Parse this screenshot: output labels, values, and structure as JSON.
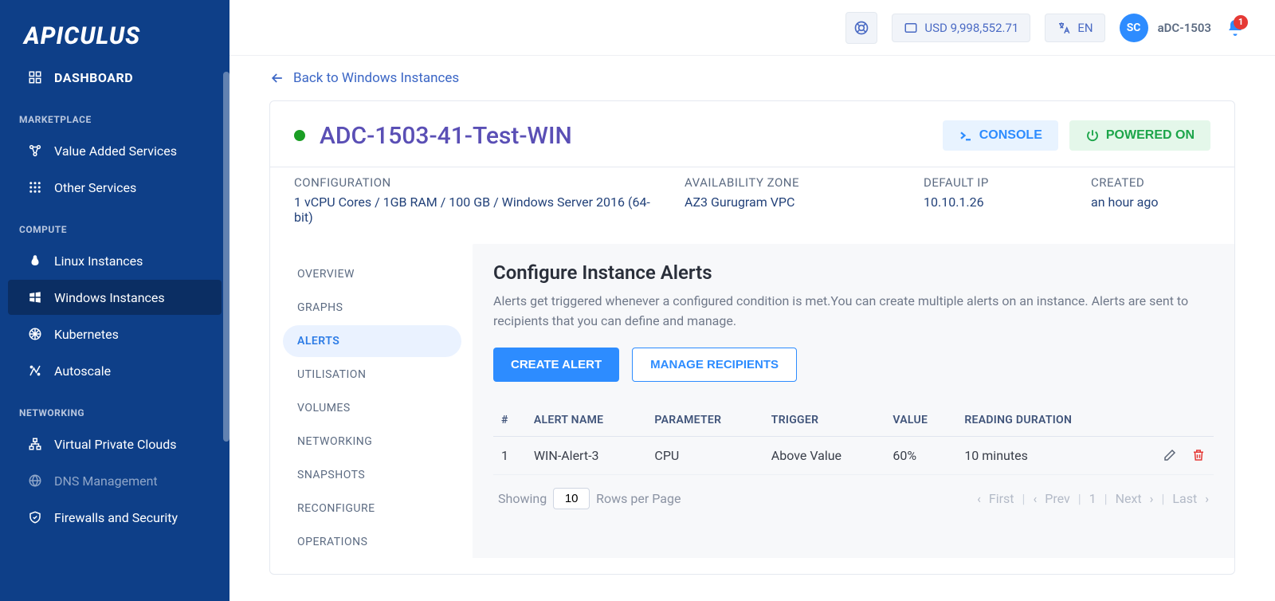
{
  "brand": "APICULUS",
  "topbar": {
    "balance": "USD 9,998,552.71",
    "language": "EN",
    "avatar_initials": "SC",
    "account_label": "aDC-1503",
    "notification_count": "1"
  },
  "sidebar": {
    "dashboard": "DASHBOARD",
    "sections": [
      {
        "label": "MARKETPLACE",
        "items": [
          {
            "icon": "vas",
            "label": "Value Added Services"
          },
          {
            "icon": "grid",
            "label": "Other Services"
          }
        ]
      },
      {
        "label": "COMPUTE",
        "items": [
          {
            "icon": "linux",
            "label": "Linux Instances"
          },
          {
            "icon": "windows",
            "label": "Windows Instances",
            "active": true
          },
          {
            "icon": "kube",
            "label": "Kubernetes"
          },
          {
            "icon": "scale",
            "label": "Autoscale"
          }
        ]
      },
      {
        "label": "NETWORKING",
        "items": [
          {
            "icon": "vpc",
            "label": "Virtual Private Clouds"
          },
          {
            "icon": "dns",
            "label": "DNS Management",
            "muted": true
          },
          {
            "icon": "firewall",
            "label": "Firewalls and Security"
          }
        ]
      }
    ]
  },
  "back_link": "Back to Windows Instances",
  "instance": {
    "title": "ADC-1503-41-Test-WIN",
    "console_btn": "CONSOLE",
    "power_btn": "POWERED ON",
    "meta": {
      "config_label": "CONFIGURATION",
      "config_value": "1 vCPU Cores / 1GB RAM / 100 GB / Windows Server 2016 (64-bit)",
      "az_label": "AVAILABILITY ZONE",
      "az_value": "AZ3 Gurugram VPC",
      "ip_label": "DEFAULT IP",
      "ip_value": "10.10.1.26",
      "created_label": "CREATED",
      "created_value": "an hour ago"
    }
  },
  "vtabs": [
    "OVERVIEW",
    "GRAPHS",
    "ALERTS",
    "UTILISATION",
    "VOLUMES",
    "NETWORKING",
    "SNAPSHOTS",
    "RECONFIGURE",
    "OPERATIONS"
  ],
  "vtab_active_index": 2,
  "panel": {
    "title": "Configure Instance Alerts",
    "desc": "Alerts get triggered whenever a configured condition is met.You can create multiple alerts on an instance. Alerts are sent to recipients that you can define and manage.",
    "create_btn": "CREATE ALERT",
    "manage_btn": "MANAGE RECIPIENTS",
    "table": {
      "headers": {
        "idx": "#",
        "name": "ALERT NAME",
        "param": "PARAMETER",
        "trigger": "TRIGGER",
        "value": "VALUE",
        "duration": "READING DURATION"
      },
      "rows": [
        {
          "idx": "1",
          "name": "WIN-Alert-3",
          "param": "CPU",
          "trigger": "Above Value",
          "value": "60%",
          "duration": "10 minutes"
        }
      ]
    },
    "pager": {
      "showing": "Showing",
      "page_size": "10",
      "rows_per_page": "Rows per Page",
      "first": "First",
      "prev": "Prev",
      "page": "1",
      "next": "Next",
      "last": "Last"
    }
  }
}
